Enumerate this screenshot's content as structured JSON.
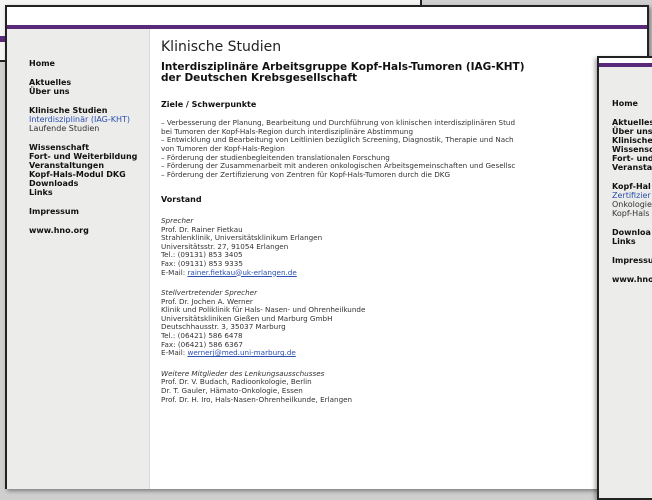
{
  "main": {
    "sidebar": {
      "group1": [
        "Home"
      ],
      "group2": [
        "Aktuelles",
        "Über uns"
      ],
      "group3_title": "Klinische Studien",
      "group3_sub": [
        "Interdisziplinär (IAG-KHT)",
        "Laufende Studien"
      ],
      "group4": [
        "Wissenschaft",
        "Fort- und Weiterbildung",
        "Veranstaltungen",
        "Kopf-Hals-Modul DKG",
        "Downloads",
        "Links"
      ],
      "group5": [
        "Impressum"
      ],
      "group6": [
        "www.hno.org"
      ]
    },
    "content": {
      "page_title": "Klinische Studien",
      "headline_line1": "Interdisziplinäre Arbeitsgruppe Kopf-Hals-Tumoren (IAG-KHT)",
      "headline_line2": "der Deutschen Krebsgesellschaft",
      "goals_heading": "Ziele / Schwerpunkte",
      "goals": [
        "– Verbesserung der Planung, Bearbeitung und Durchführung von klinischen interdisziplinären Stud",
        "   bei Tumoren der Kopf-Hals-Region durch interdisziplinäre Abstimmung",
        "– Entwicklung und Bearbeitung von Leitlinien bezüglich Screening, Diagnostik, Therapie und Nach",
        "   von Tumoren der Kopf-Hals-Region",
        "– Förderung der studienbegleitenden translationalen Forschung",
        "– Förderung der Zusammenarbeit mit anderen onkologischen Arbeitsgemeinschaften und Gesellsc",
        "– Förderung der Zertifizierung von Zentren für Kopf-Hals-Tumoren durch die DKG"
      ],
      "board_heading": "Vorstand",
      "speaker": {
        "role": "Sprecher",
        "lines": [
          "Prof. Dr. Rainer Fietkau",
          "Strahlenklinik, Universitätsklinikum Erlangen",
          "Universitätsstr. 27, 91054 Erlangen",
          "Tel.: (09131) 853 3405",
          "Fax: (09131) 853 9335"
        ],
        "email_label": "E-Mail: ",
        "email": "rainer.fietkau@uk-erlangen.de"
      },
      "deputy": {
        "role": "Stellvertretender Sprecher",
        "lines": [
          "Prof. Dr. Jochen A. Werner",
          "Klinik und Poliklinik für Hals- Nasen- und Ohrenheilkunde",
          "Universitätskliniken Gießen und Marburg GmbH",
          "Deutschhausstr. 3, 35037 Marburg",
          "Tel.: (06421) 586 6478",
          "Fax: (06421) 586 6367"
        ],
        "email_label": "E-Mail: ",
        "email": "wernerj@med.uni-marburg.de"
      },
      "committee": {
        "role": "Weitere Mitglieder des Lenkungsausschusses",
        "lines": [
          "Prof. Dr. V. Budach, Radioonkologie, Berlin",
          "Dr. T. Gauler, Hämato-Onkologie, Essen",
          "Prof. Dr. H. Iro, Hals-Nasen-Ohrenheilkunde, Erlangen"
        ]
      }
    }
  },
  "right_window": {
    "sidebar": {
      "group1": [
        "Home"
      ],
      "group2": [
        "Aktuelles",
        "Über uns",
        "Klinische",
        "Wissensc",
        "Fort- und",
        "Veransta"
      ],
      "group3": [
        "Kopf-Hal"
      ],
      "group3_sub": [
        "Zertifizier",
        "Onkologie",
        "Kopf-Hals"
      ],
      "group4": [
        "Downloa",
        "Links"
      ],
      "group5": [
        "Impressu"
      ],
      "group6": [
        "www.hno"
      ]
    }
  },
  "colors": {
    "accent_stripe": "#5a2a7a",
    "link": "#2a4fb0",
    "sidebar_bg": "#ececea"
  }
}
